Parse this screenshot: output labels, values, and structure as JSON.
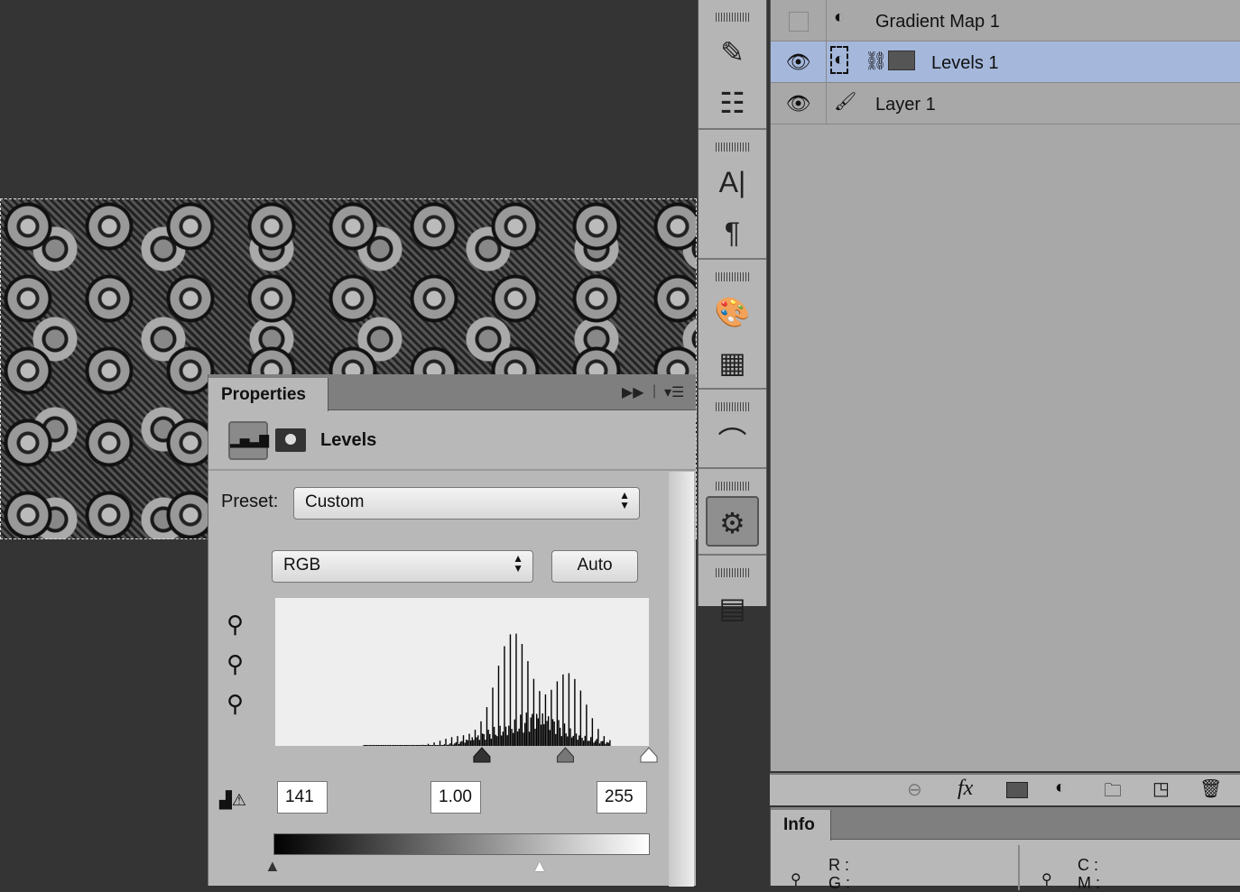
{
  "properties": {
    "tab": "Properties",
    "title": "Levels",
    "preset_label": "Preset:",
    "preset_value": "Custom",
    "channel": "RGB",
    "auto": "Auto",
    "input_black": "141",
    "input_gamma": "1.00",
    "input_white": "255"
  },
  "histogram": {
    "range_start": 0,
    "range_end": 255,
    "black_point": 141,
    "white_point": 255,
    "gamma": 1.0
  },
  "layers": [
    {
      "name": "Gradient Map 1",
      "visible": false
    },
    {
      "name": "Levels 1",
      "visible": true,
      "selected": true
    },
    {
      "name": "Layer 1",
      "visible": true
    }
  ],
  "info": {
    "tab": "Info",
    "r": "R :",
    "g": "G :",
    "c": "C :",
    "m": "M :"
  },
  "colors": {
    "selection": "#a5b8dc",
    "panel": "#b8b8b8"
  }
}
